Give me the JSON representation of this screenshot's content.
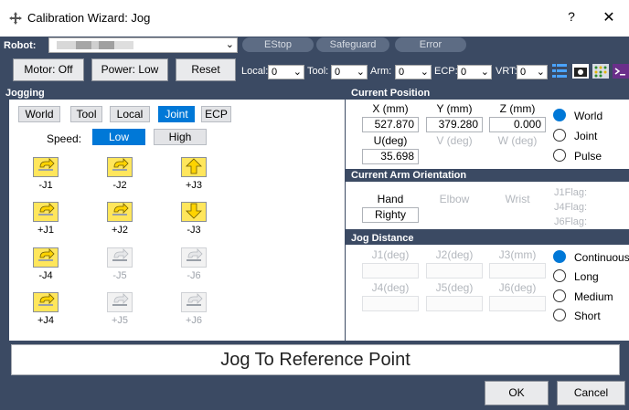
{
  "window": {
    "title": "Calibration Wizard: Jog",
    "help": "?",
    "close": "✕"
  },
  "toolbar": {
    "robot_label": "Robot:",
    "estop": "EStop",
    "safeguard": "Safeguard",
    "error": "Error",
    "motor": "Motor: Off",
    "power": "Power: Low",
    "reset": "Reset",
    "local_label": "Local:",
    "local_value": "0",
    "tool_label": "Tool:",
    "tool_value": "0",
    "arm_label": "Arm:",
    "arm_value": "0",
    "ecp_label": "ECP:",
    "ecp_value": "0",
    "vrt_label": "VRT:",
    "vrt_value": "0"
  },
  "jogging": {
    "header": "Jogging",
    "modes": [
      "World",
      "Tool",
      "Local",
      "Joint",
      "ECP"
    ],
    "active_mode": "Joint",
    "speed_label": "Speed:",
    "speed_low": "Low",
    "speed_high": "High",
    "buttons": [
      {
        "label": "-J1",
        "enabled": true
      },
      {
        "label": "-J2",
        "enabled": true
      },
      {
        "label": "+J3",
        "enabled": true
      },
      {
        "label": "+J1",
        "enabled": true
      },
      {
        "label": "+J2",
        "enabled": true
      },
      {
        "label": "-J3",
        "enabled": true
      },
      {
        "label": "-J4",
        "enabled": true
      },
      {
        "label": "-J5",
        "enabled": false
      },
      {
        "label": "-J6",
        "enabled": false
      },
      {
        "label": "+J4",
        "enabled": true
      },
      {
        "label": "+J5",
        "enabled": false
      },
      {
        "label": "+J6",
        "enabled": false
      }
    ]
  },
  "position": {
    "header": "Current Position",
    "x_label": "X (mm)",
    "y_label": "Y (mm)",
    "z_label": "Z (mm)",
    "x": "527.870",
    "y": "379.280",
    "z": "0.000",
    "u_label": "U(deg)",
    "v_label": "V (deg)",
    "w_label": "W (deg)",
    "u": "35.698",
    "modes": [
      "World",
      "Joint",
      "Pulse"
    ],
    "selected": "World"
  },
  "orientation": {
    "header": "Current Arm Orientation",
    "hand_label": "Hand",
    "elbow_label": "Elbow",
    "wrist_label": "Wrist",
    "hand_value": "Righty",
    "j1flag": "J1Flag:",
    "j4flag": "J4Flag:",
    "j6flag": "J6Flag:"
  },
  "jog_distance": {
    "header": "Jog Distance",
    "labels": [
      "J1(deg)",
      "J2(deg)",
      "J3(mm)",
      "J4(deg)",
      "J5(deg)",
      "J6(deg)"
    ],
    "options": [
      "Continuous",
      "Long",
      "Medium",
      "Short"
    ],
    "selected": "Continuous"
  },
  "actions": {
    "reference": "Jog To Reference Point",
    "ok": "OK",
    "cancel": "Cancel"
  }
}
